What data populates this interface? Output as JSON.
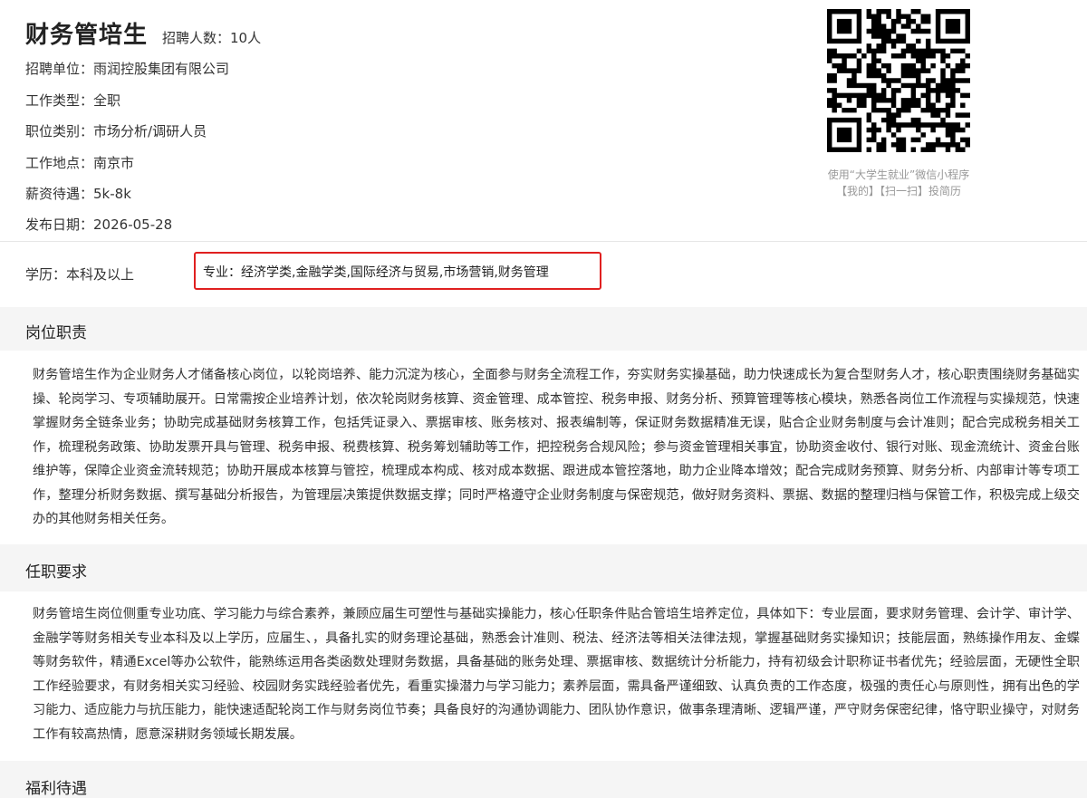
{
  "job": {
    "title": "财务管培生",
    "headcount": "招聘人数：10人",
    "fields": [
      {
        "label": "招聘单位：",
        "value": "雨润控股集团有限公司"
      },
      {
        "label": "工作类型：",
        "value": "全职"
      },
      {
        "label": "职位类别：",
        "value": "市场分析/调研人员"
      },
      {
        "label": "工作地点：",
        "value": "南京市"
      },
      {
        "label": "薪资待遇：",
        "value": "5k-8k"
      },
      {
        "label": "发布日期：",
        "value": "2026-05-28"
      }
    ]
  },
  "qr": {
    "icon": "qr-code",
    "caption_line1": "使用“大学生就业”微信小程序",
    "caption_line2": "【我的】【扫一扫】投简历"
  },
  "requirements": {
    "education": "学历：本科及以上",
    "major": "专业：经济学类,金融学类,国际经济与贸易,市场营销,财务管理",
    "highlight_color": "#e02020"
  },
  "sections": {
    "duties": {
      "title": "岗位职责",
      "text": "财务管培生作为企业财务人才储备核心岗位，以轮岗培养、能力沉淀为核心，全面参与财务全流程工作，夯实财务实操基础，助力快速成长为复合型财务人才，核心职责围绕财务基础实操、轮岗学习、专项辅助展开。日常需按企业培养计划，依次轮岗财务核算、资金管理、成本管控、税务申报、财务分析、预算管理等核心模块，熟悉各岗位工作流程与实操规范，快速掌握财务全链条业务；协助完成基础财务核算工作，包括凭证录入、票据审核、账务核对、报表编制等，保证财务数据精准无误，贴合企业财务制度与会计准则；配合完成税务相关工作，梳理税务政策、协助发票开具与管理、税务申报、税费核算、税务筹划辅助等工作，把控税务合规风险；参与资金管理相关事宜，协助资金收付、银行对账、现金流统计、资金台账维护等，保障企业资金流转规范；协助开展成本核算与管控，梳理成本构成、核对成本数据、跟进成本管控落地，助力企业降本增效；配合完成财务预算、财务分析、内部审计等专项工作，整理分析财务数据、撰写基础分析报告，为管理层决策提供数据支撑；同时严格遵守企业财务制度与保密规范，做好财务资料、票据、数据的整理归档与保管工作，积极完成上级交办的其他财务相关任务。"
    },
    "qualifications": {
      "title": "任职要求",
      "text": "财务管培生岗位侧重专业功底、学习能力与综合素养，兼顾应届生可塑性与基础实操能力，核心任职条件贴合管培生培养定位，具体如下：专业层面，要求财务管理、会计学、审计学、金融学等财务相关专业本科及以上学历，应届生、，具备扎实的财务理论基础，熟悉会计准则、税法、经济法等相关法律法规，掌握基础财务实操知识；技能层面，熟练操作用友、金蝶等财务软件，精通Excel等办公软件，能熟练运用各类函数处理财务数据，具备基础的账务处理、票据审核、数据统计分析能力，持有初级会计职称证书者优先；经验层面，无硬性全职工作经验要求，有财务相关实习经验、校园财务实践经验者优先，看重实操潜力与学习能力；素养层面，需具备严谨细致、认真负责的工作态度，极强的责任心与原则性，拥有出色的学习能力、适应能力与抗压能力，能快速适配轮岗工作与财务岗位节奏；具备良好的沟通协调能力、团队协作意识，做事条理清晰、逻辑严谨，严守财务保密纪律，恪守职业操守，对财务工作有较高热情，愿意深耕财务领域长期发展。"
    },
    "benefits": {
      "title": "福利待遇"
    }
  }
}
